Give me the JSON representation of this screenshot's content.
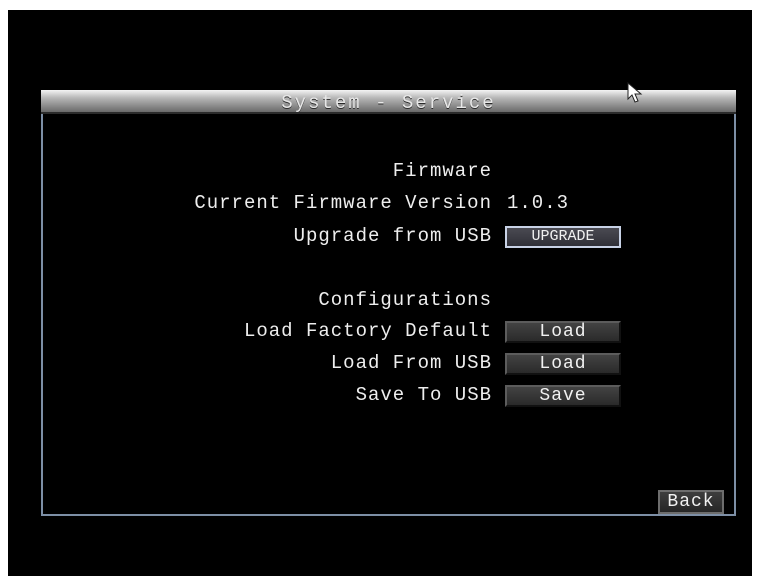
{
  "dialog": {
    "title": "System - Service"
  },
  "firmware": {
    "heading": "Firmware",
    "current_version_label": "Current Firmware Version",
    "current_version_value": "1.0.3",
    "upgrade_label": "Upgrade from USB",
    "upgrade_button": "UPGRADE"
  },
  "configurations": {
    "heading": "Configurations",
    "factory_default_label": "Load Factory Default",
    "factory_default_button": "Load",
    "load_from_usb_label": "Load From USB",
    "load_from_usb_button": "Load",
    "save_to_usb_label": "Save To USB",
    "save_to_usb_button": "Save"
  },
  "footer": {
    "back_button": "Back"
  },
  "icons": {
    "cursor": "mouse-pointer-icon"
  },
  "colors": {
    "background": "#000000",
    "border": "#7d8fa6",
    "text": "#eeeeee"
  }
}
